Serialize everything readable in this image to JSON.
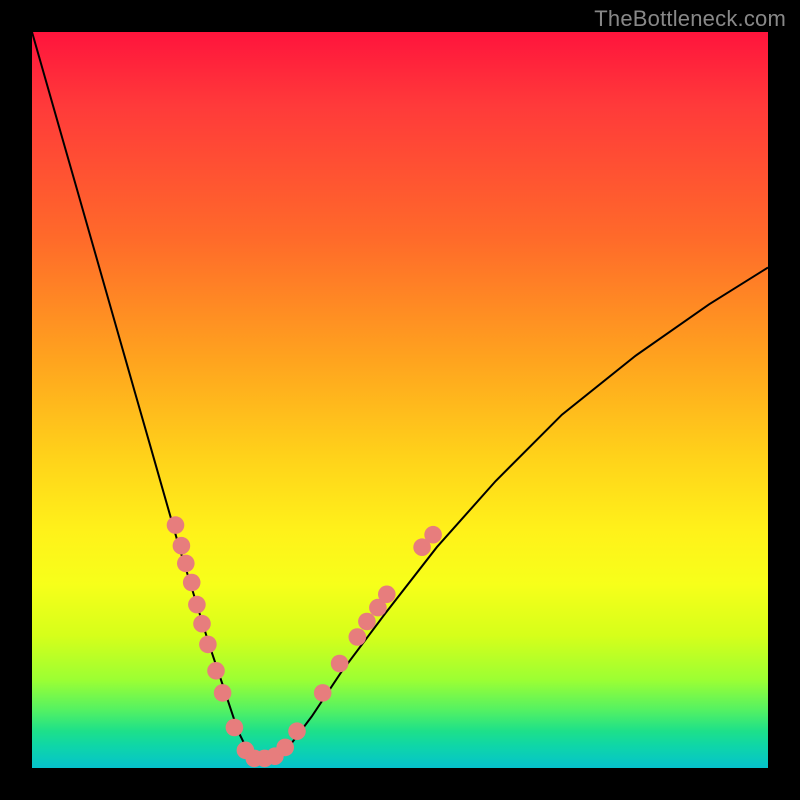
{
  "watermark": "TheBottleneck.com",
  "chart_data": {
    "type": "line",
    "title": "",
    "xlabel": "",
    "ylabel": "",
    "x_range": [
      0,
      100
    ],
    "y_range": [
      0,
      100
    ],
    "series": [
      {
        "name": "curve",
        "x": [
          0,
          2,
          4,
          6,
          8,
          10,
          12,
          14,
          16,
          18,
          20,
          22,
          24,
          26,
          27,
          28,
          29,
          30,
          31,
          33,
          35,
          38,
          42,
          48,
          55,
          63,
          72,
          82,
          92,
          100
        ],
        "y": [
          100,
          93,
          86,
          79,
          72,
          65,
          58,
          51,
          44,
          37,
          30,
          23.5,
          17,
          11,
          8,
          5,
          3,
          1.5,
          1,
          1,
          3,
          7,
          13,
          21,
          30,
          39,
          48,
          56,
          63,
          68
        ]
      }
    ],
    "markers": [
      {
        "x": 19.5,
        "y": 33.0
      },
      {
        "x": 20.3,
        "y": 30.2
      },
      {
        "x": 20.9,
        "y": 27.8
      },
      {
        "x": 21.7,
        "y": 25.2
      },
      {
        "x": 22.4,
        "y": 22.2
      },
      {
        "x": 23.1,
        "y": 19.6
      },
      {
        "x": 23.9,
        "y": 16.8
      },
      {
        "x": 25.0,
        "y": 13.2
      },
      {
        "x": 25.9,
        "y": 10.2
      },
      {
        "x": 27.5,
        "y": 5.5
      },
      {
        "x": 29.0,
        "y": 2.4
      },
      {
        "x": 30.2,
        "y": 1.3
      },
      {
        "x": 31.6,
        "y": 1.3
      },
      {
        "x": 33.0,
        "y": 1.6
      },
      {
        "x": 34.4,
        "y": 2.8
      },
      {
        "x": 36.0,
        "y": 5.0
      },
      {
        "x": 39.5,
        "y": 10.2
      },
      {
        "x": 41.8,
        "y": 14.2
      },
      {
        "x": 44.2,
        "y": 17.8
      },
      {
        "x": 45.5,
        "y": 19.9
      },
      {
        "x": 47.0,
        "y": 21.8
      },
      {
        "x": 48.2,
        "y": 23.6
      },
      {
        "x": 53.0,
        "y": 30.0
      },
      {
        "x": 54.5,
        "y": 31.7
      }
    ],
    "marker_radius": 1.2,
    "grid": false,
    "legend": false,
    "background_gradient": {
      "top": "#ff143c",
      "bottom": "#06c2cc"
    }
  }
}
